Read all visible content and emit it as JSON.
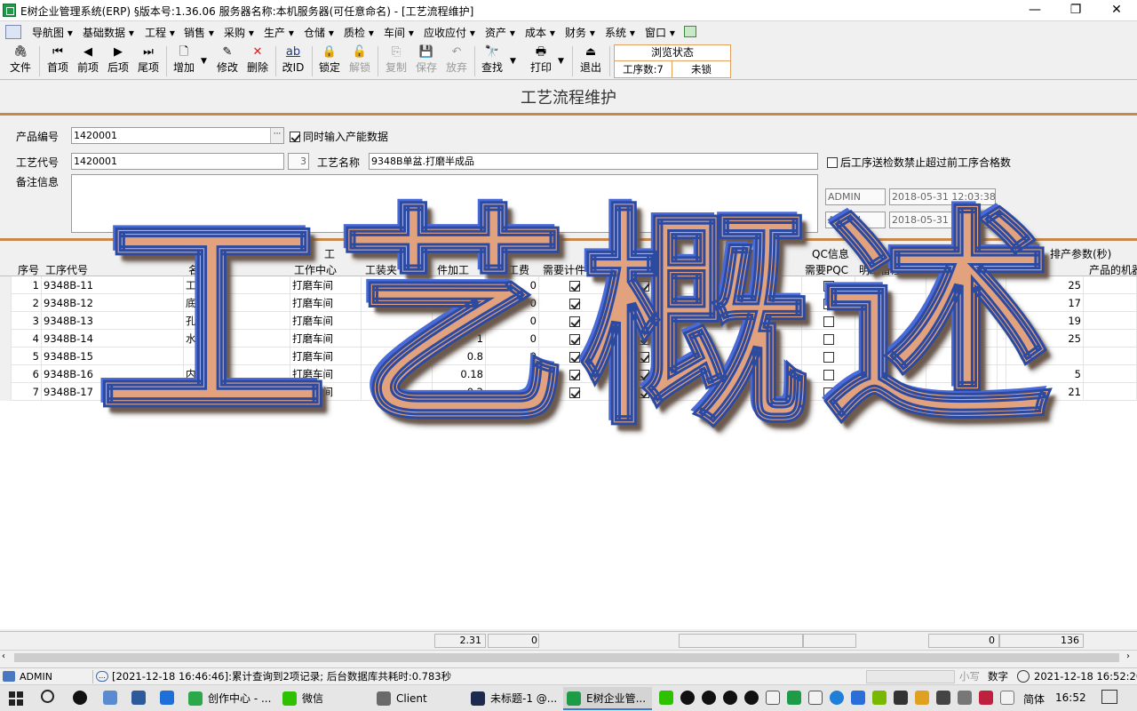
{
  "window": {
    "title": "E树企业管理系统(ERP) §版本号:1.36.06  服务器名称:本机服务器(可任意命名) - [工艺流程维护]",
    "controls": [
      "—",
      "❐",
      "✕"
    ]
  },
  "menu": [
    "导航图",
    "基础数据",
    "工程",
    "销售",
    "采购",
    "生产",
    "仓储",
    "质检",
    "车间",
    "应收应付",
    "资产",
    "成本",
    "财务",
    "系统",
    "窗口"
  ],
  "toolbar": {
    "buttons": [
      {
        "label": "文件",
        "icon": "paperclip-icon",
        "glyph": "🖇"
      },
      {
        "label": "首项",
        "icon": "first-icon",
        "glyph": "⏮"
      },
      {
        "label": "前项",
        "icon": "prev-icon",
        "glyph": "◀"
      },
      {
        "label": "后项",
        "icon": "next-icon",
        "glyph": "▶"
      },
      {
        "label": "尾项",
        "icon": "last-icon",
        "glyph": "⏭"
      },
      {
        "label": "增加",
        "icon": "new-doc-icon",
        "glyph": "🗋"
      },
      {
        "label": "修改",
        "icon": "edit-icon",
        "glyph": "✎"
      },
      {
        "label": "删除",
        "icon": "delete-icon",
        "glyph": "✕"
      },
      {
        "label": "改ID",
        "icon": "rename-icon",
        "glyph": "ab"
      },
      {
        "label": "锁定",
        "icon": "lock-icon",
        "glyph": "🔒"
      },
      {
        "label": "解锁",
        "icon": "unlock-icon",
        "glyph": "🔓"
      },
      {
        "label": "复制",
        "icon": "copy-icon",
        "glyph": "⎘"
      },
      {
        "label": "保存",
        "icon": "save-icon",
        "glyph": "💾"
      },
      {
        "label": "放弃",
        "icon": "undo-icon",
        "glyph": "↶"
      },
      {
        "label": "查找",
        "icon": "binoculars-icon",
        "glyph": "🔭"
      },
      {
        "label": "打印",
        "icon": "printer-icon",
        "glyph": "🖶"
      },
      {
        "label": "退出",
        "icon": "exit-icon",
        "glyph": "⏏"
      }
    ],
    "state_title": "浏览状态",
    "process_count": "工序数:7",
    "lock_state": "未锁"
  },
  "form": {
    "title": "工艺流程维护",
    "product_code_label": "产品编号",
    "product_code": "1420001",
    "browse_btn": "···",
    "capacity_check_label": "同时输入产能数据",
    "process_code_label": "工艺代号",
    "process_code": "1420001",
    "process_seq": "3",
    "process_name_label": "工艺名称",
    "process_name": "9348B单盆.打磨半成品",
    "qc_limit_label": "后工序送检数禁止超过前工序合格数",
    "remark_label": "备注信息",
    "created_by": "ADMIN",
    "created_at": "2018-05-31 12:03:38",
    "modified_by": "ADMIN",
    "modified_at": "2018-05-31 22:15:37"
  },
  "grid": {
    "group_headers": [
      "工",
      "与",
      "工序偏置",
      "QC信息",
      "其",
      "固定消耗...",
      "排产参数(秒)"
    ],
    "columns": [
      "序号",
      "工序代号",
      "名称",
      "工作中心",
      "工装夹",
      "件加工",
      "件加工费",
      "需要计件",
      "排",
      "(单",
      "时间(分/天)",
      "需要PQC",
      "明细备注",
      "产品的机器"
    ],
    "rows": [
      {
        "seq": "1",
        "code": "9348B-11",
        "name": "工磨底",
        "center": "打磨车间",
        "time": "",
        "fee": "0",
        "piece": true,
        "flag": true,
        "pqc": false,
        "sched": "25"
      },
      {
        "seq": "2",
        "code": "9348B-12",
        "name": "底",
        "center": "打磨车间",
        "time": "",
        "fee": "0",
        "piece": true,
        "flag": true,
        "pqc": false,
        "sched": "17"
      },
      {
        "seq": "3",
        "code": "9348B-13",
        "name": "孔",
        "center": "打磨车间",
        "time": "",
        "fee": "0",
        "piece": true,
        "flag": true,
        "pqc": false,
        "sched": "19"
      },
      {
        "seq": "4",
        "code": "9348B-14",
        "name": "水孔",
        "center": "打磨车间",
        "time": "1",
        "fee": "0",
        "piece": true,
        "flag": true,
        "pqc": false,
        "sched": "25"
      },
      {
        "seq": "5",
        "code": "9348B-15",
        "name": "",
        "center": "打磨车间",
        "time": "0.8",
        "fee": "0",
        "piece": true,
        "flag": true,
        "pqc": false,
        "sched": ""
      },
      {
        "seq": "6",
        "code": "9348B-16",
        "name": "内侧",
        "center": "打磨车间",
        "time": "0.18",
        "fee": "0",
        "piece": true,
        "flag": true,
        "pqc": false,
        "sched": "5"
      },
      {
        "seq": "7",
        "code": "9348B-17",
        "name": "工磨内侧",
        "center": "打磨车间",
        "time": "0.2",
        "fee": "0",
        "piece": true,
        "flag": true,
        "pqc": false,
        "sched": "21"
      }
    ],
    "totals": {
      "time": "2.31",
      "fee": "0",
      "fixed": "0",
      "sched": "136"
    }
  },
  "status": {
    "user": "ADMIN",
    "message": "[2021-12-18 16:46:46]:累计查询到2项记录; 后台数据库共耗时:0.783秒",
    "ime_small": "小写",
    "ime_num": "数字",
    "datetime": "2021-12-18  16:52:20"
  },
  "taskbar": {
    "apps": [
      {
        "label": "创作中心 - ...",
        "color": "#2aa84a"
      },
      {
        "label": "微信",
        "color": "#2dc100"
      },
      {
        "label": "Client",
        "color": "#6a6a6a"
      },
      {
        "label": "未标题-1 @...",
        "color": "#1b2a4e"
      },
      {
        "label": "E树企业管...",
        "color": "#1e9b47"
      }
    ],
    "lang": "简体",
    "time": "16:52"
  },
  "overlay": {
    "text": "工艺概述",
    "fill": "#e1a27d",
    "outline": "#2b4aa0"
  },
  "colors": {
    "accent_line": "#c8884c",
    "state_border": "#e0a060"
  }
}
